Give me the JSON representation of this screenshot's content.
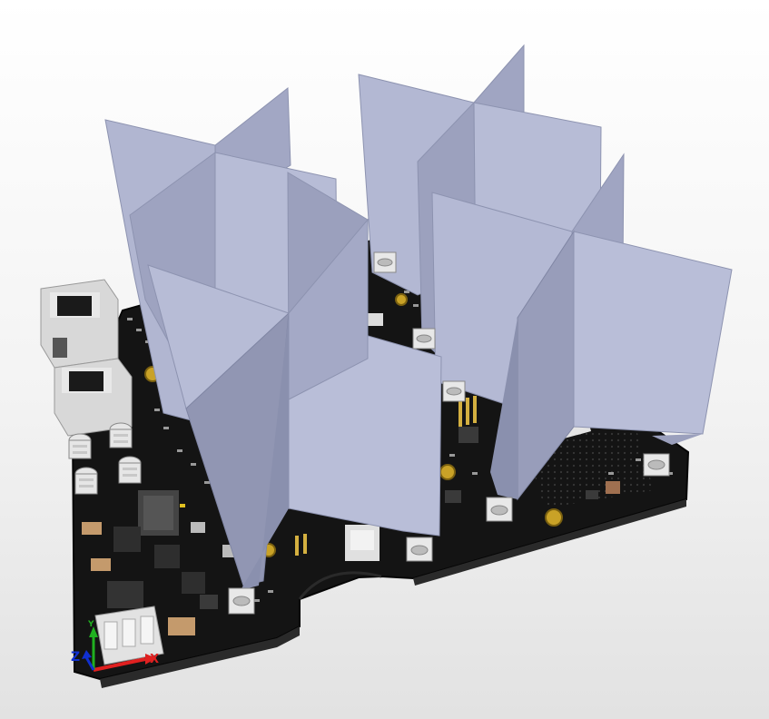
{
  "axis_triad": {
    "x_label": "X",
    "y_label": "Y",
    "z_label": "Z"
  },
  "colors": {
    "pcb": "#111111",
    "fin_light": "#b9bed6",
    "fin_mid": "#a7acc8",
    "fin_dark": "#8a90ae",
    "connector": "#dedede",
    "gold": "#c9a227",
    "axis_x": "#e02020",
    "axis_y": "#20b020",
    "axis_z": "#1030d0"
  }
}
